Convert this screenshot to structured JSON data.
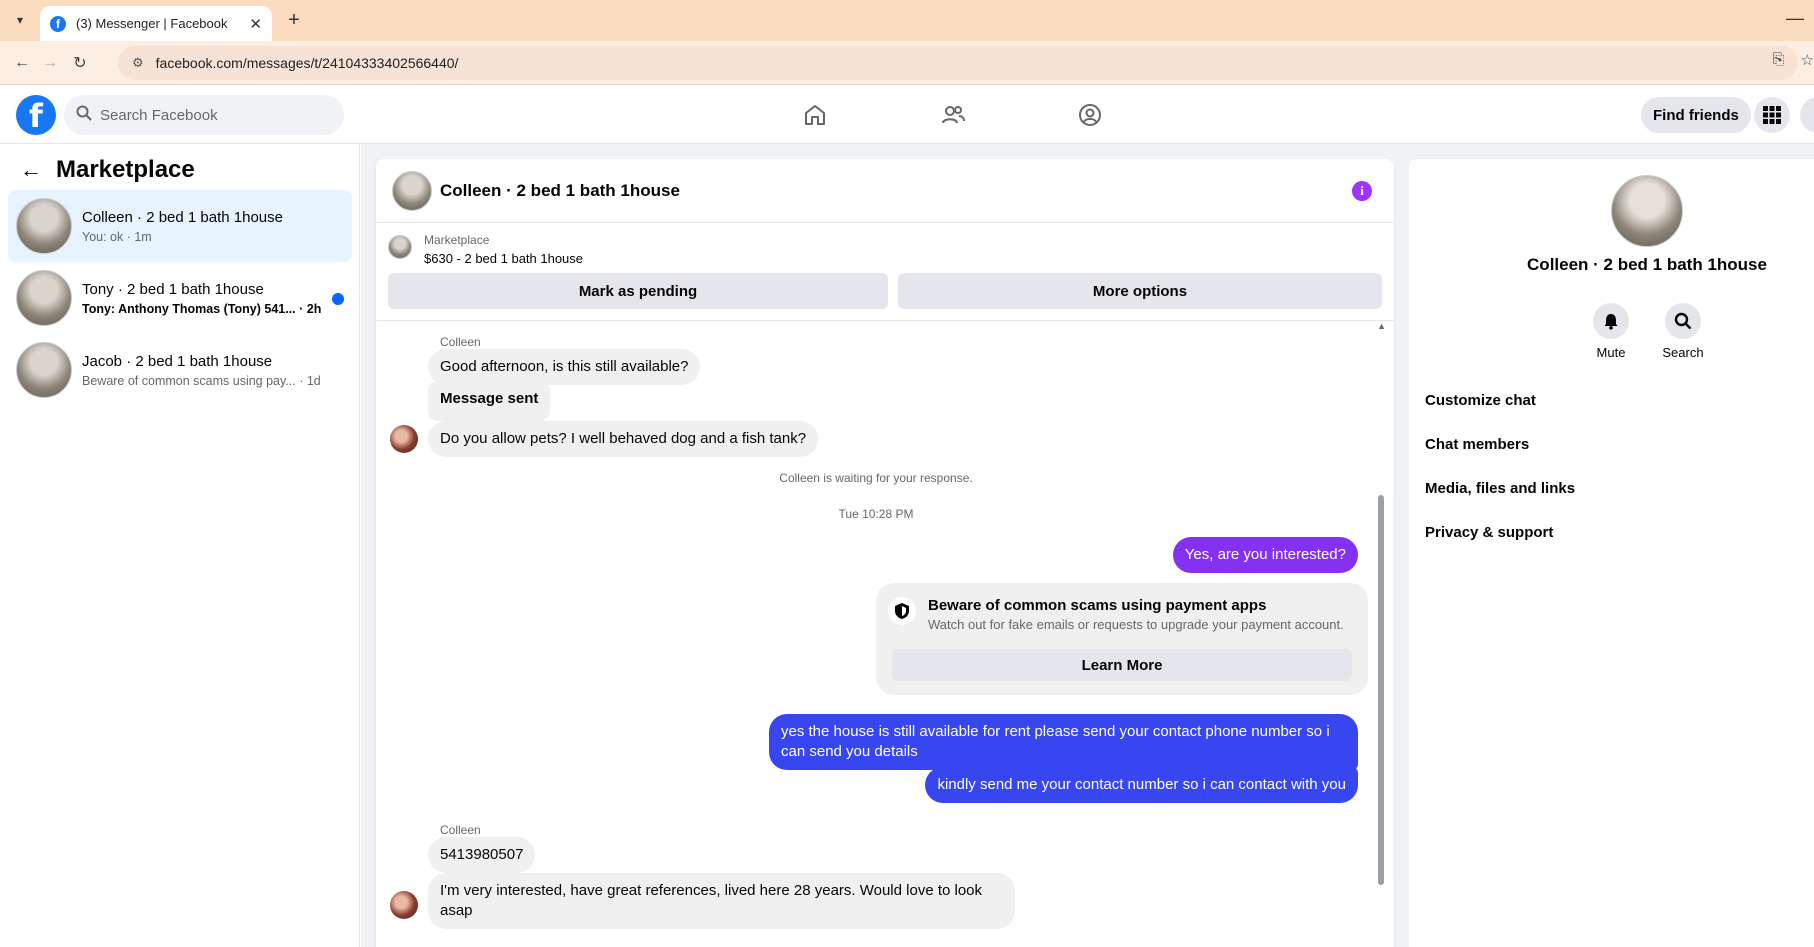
{
  "browser": {
    "tab_title": "(3) Messenger | Facebook",
    "url": "facebook.com/messages/t/24104333402566440/"
  },
  "fbnav": {
    "search_placeholder": "Search Facebook",
    "find_friends": "Find friends"
  },
  "left": {
    "title": "Marketplace",
    "conversations": [
      {
        "name": "Colleen · 2 bed 1 bath 1house",
        "subtitle": "You: ok · 1m",
        "active": true,
        "unread": false
      },
      {
        "name": "Tony · 2 bed 1 bath 1house",
        "subtitle": "Tony: Anthony Thomas (Tony) 541... · 2h",
        "active": false,
        "unread": true
      },
      {
        "name": "Jacob · 2 bed 1 bath 1house",
        "subtitle": "Beware of common scams using pay... · 1d",
        "active": false,
        "unread": false
      }
    ]
  },
  "chat": {
    "title": "Colleen · 2 bed 1 bath 1house",
    "listing": {
      "source": "Marketplace",
      "price_title": "$630 - 2 bed 1 bath 1house",
      "mark_pending": "Mark as pending",
      "more_options": "More options"
    },
    "messages": {
      "sender1": "Colleen",
      "m1": "Good afternoon, is this still available?",
      "m2": "Message sent",
      "m3": "Do you allow pets? I well behaved dog and a fish tank?",
      "waiting": "Colleen is waiting for your response.",
      "timestamp": "Tue 10:28 PM",
      "out1": "Yes, are you interested?",
      "scam_title": "Beware of common scams using payment apps",
      "scam_desc": "Watch out for fake emails or requests to upgrade your payment account.",
      "learn_more": "Learn More",
      "out2_line1": "yes the house is still available for rent please send your contact phone number so i",
      "out2_line2": "can send you details",
      "out3": "kindly send me your contact number so i can contact with you",
      "sender2": "Colleen",
      "m4": "5413980507",
      "m5_line1": "I'm very interested,  have great references, lived here 28 years. Would love to look",
      "m5_line2": "asap"
    }
  },
  "right": {
    "name": "Colleen · 2 bed 1 bath 1house",
    "mute": "Mute",
    "search": "Search",
    "items": [
      "Customize chat",
      "Chat members",
      "Media, files and links",
      "Privacy & support"
    ]
  },
  "colors": {
    "accent_blue": "#1877f2",
    "bubble_purple": "#8531f2",
    "bubble_blue": "#3846f0",
    "info_purple": "#a033ff"
  }
}
